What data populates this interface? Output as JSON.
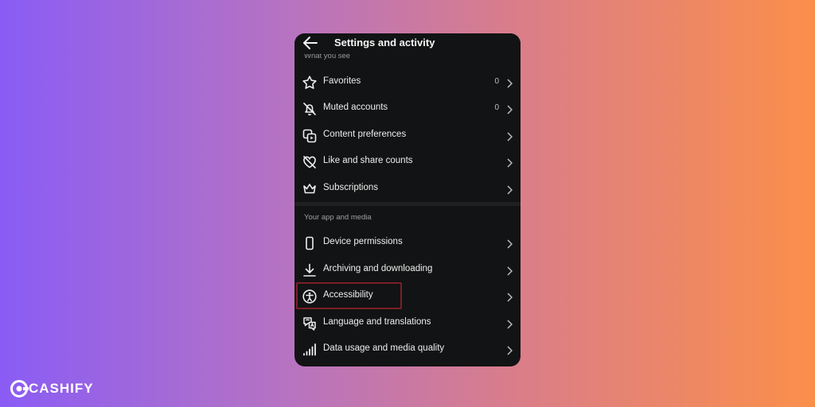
{
  "header": {
    "title": "Settings and activity",
    "back_icon": "arrow-left-icon"
  },
  "section_partial": {
    "label": "What you see"
  },
  "what_you_see": [
    {
      "label": "Favorites",
      "count": "0",
      "icon": "star-icon"
    },
    {
      "label": "Muted accounts",
      "count": "0",
      "icon": "muted-bell-icon"
    },
    {
      "label": "Content preferences",
      "count": "",
      "icon": "content-preferences-icon"
    },
    {
      "label": "Like and share counts",
      "count": "",
      "icon": "heart-off-icon"
    },
    {
      "label": "Subscriptions",
      "count": "",
      "icon": "crown-icon"
    }
  ],
  "app_media": {
    "header": "Your app and media",
    "items": [
      {
        "label": "Device permissions",
        "icon": "phone-icon"
      },
      {
        "label": "Archiving and downloading",
        "icon": "download-icon"
      },
      {
        "label": "Accessibility",
        "icon": "accessibility-icon",
        "highlighted": true
      },
      {
        "label": "Language and translations",
        "icon": "translate-icon"
      },
      {
        "label": "Data usage and media quality",
        "icon": "signal-bars-icon"
      }
    ]
  },
  "brand": {
    "name": "CASHIFY",
    "highlight_color": "#7a1f24"
  }
}
